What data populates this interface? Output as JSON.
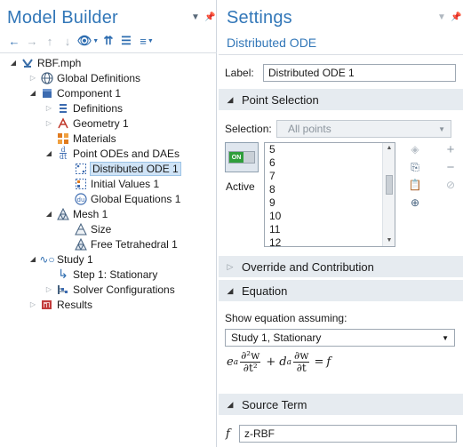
{
  "model_builder": {
    "title": "Model Builder",
    "tree": [
      {
        "label": "RBF.mph",
        "icon": "model-file-icon"
      },
      {
        "label": "Global Definitions",
        "icon": "globe-icon"
      },
      {
        "label": "Component 1",
        "icon": "component-icon"
      },
      {
        "label": "Definitions",
        "icon": "definitions-icon"
      },
      {
        "label": "Geometry 1",
        "icon": "geometry-icon"
      },
      {
        "label": "Materials",
        "icon": "materials-icon"
      },
      {
        "label": "Point ODEs and DAEs",
        "icon": "ode-interface-icon"
      },
      {
        "label": "Distributed ODE 1",
        "icon": "distributed-ode-icon"
      },
      {
        "label": "Initial Values 1",
        "icon": "initial-values-icon"
      },
      {
        "label": "Global Equations 1",
        "icon": "global-equations-icon"
      },
      {
        "label": "Mesh 1",
        "icon": "mesh-icon"
      },
      {
        "label": "Size",
        "icon": "mesh-size-icon"
      },
      {
        "label": "Free Tetrahedral 1",
        "icon": "free-tetrahedral-icon"
      },
      {
        "label": "Study 1",
        "icon": "study-icon"
      },
      {
        "label": "Step 1: Stationary",
        "icon": "study-step-icon"
      },
      {
        "label": "Solver Configurations",
        "icon": "solver-icon"
      },
      {
        "label": "Results",
        "icon": "results-icon"
      }
    ]
  },
  "settings": {
    "title": "Settings",
    "subtitle": "Distributed ODE",
    "label_caption": "Label:",
    "label_value": "Distributed ODE 1",
    "point_selection": {
      "header": "Point Selection",
      "selection_caption": "Selection:",
      "selection_value": "All points",
      "active_caption": "Active",
      "toggle_text": "ON",
      "items": [
        "5",
        "6",
        "7",
        "8",
        "9",
        "10",
        "11",
        "12"
      ]
    },
    "override": {
      "header": "Override and Contribution"
    },
    "equation": {
      "header": "Equation",
      "show_caption": "Show equation assuming:",
      "study_value": "Study 1, Stationary",
      "formula": {
        "ea": "e",
        "ea_sub": "a",
        "d2": "∂²w",
        "dt2": "∂t²",
        "plus": "+",
        "da": "d",
        "da_sub": "a",
        "dw": "∂w",
        "dt": "∂t",
        "eq": "=",
        "rhs": "f"
      }
    },
    "source_term": {
      "header": "Source Term",
      "f_label": "f",
      "value": "z-RBF"
    }
  },
  "colors": {
    "title_blue": "#3277b8",
    "section_bg": "#e6ebf0",
    "selection_bg": "#cfe3f6",
    "toggle_green": "#2f9e3b"
  }
}
